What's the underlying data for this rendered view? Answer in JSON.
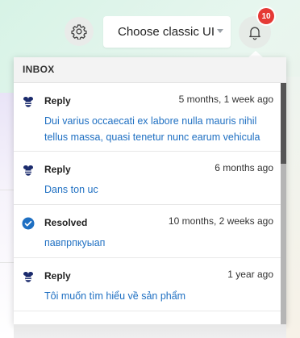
{
  "topbar": {
    "select_label": "Choose classic UI",
    "badge_count": "10"
  },
  "inbox": {
    "title": "INBOX",
    "notifications": [
      {
        "type": "Reply",
        "time": "5 months, 1 week ago",
        "message": "Dui varius occaecati ex labore nulla mauris nihil tellus massa, quasi tenetur nunc earum vehicula",
        "icon": "bee-icon"
      },
      {
        "type": "Reply",
        "time": "6 months ago",
        "message": "Dans ton uc",
        "icon": "bee-icon"
      },
      {
        "type": "Resolved",
        "time": "10 months, 2 weeks ago",
        "message": "павпрпкуыап",
        "icon": "check-circle-icon"
      },
      {
        "type": "Reply",
        "time": "1 year ago",
        "message": "Tôi muốn tìm hiểu về sản phẩm",
        "icon": "bee-icon"
      }
    ]
  },
  "colors": {
    "link": "#1e6fc2",
    "badge": "#e53935",
    "resolved_icon": "#1e6fc2"
  }
}
